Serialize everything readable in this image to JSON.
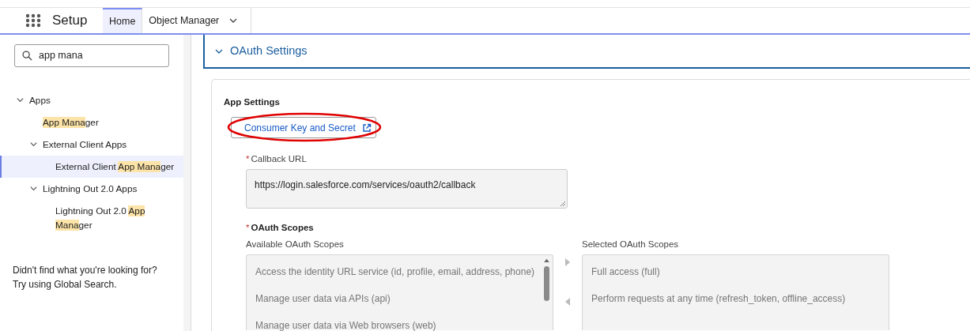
{
  "header": {
    "title": "Setup",
    "tabs": [
      {
        "label": "Home",
        "selected": true,
        "dropdown": false
      },
      {
        "label": "Object Manager",
        "selected": false,
        "dropdown": true
      }
    ]
  },
  "sidebar": {
    "search": {
      "value": "app mana"
    },
    "tree": [
      {
        "parts": [
          {
            "text": "Apps",
            "match": false
          }
        ],
        "expanded": true,
        "selected": false,
        "children": [
          {
            "parts": [
              {
                "text": "App Mana",
                "match": true
              },
              {
                "text": "ger",
                "match": false
              }
            ],
            "selected": false
          },
          {
            "parts": [
              {
                "text": "External Client Apps",
                "match": false
              }
            ],
            "expanded": true,
            "selected": false,
            "children": [
              {
                "parts": [
                  {
                    "text": "External Client ",
                    "match": false
                  },
                  {
                    "text": "App Mana",
                    "match": true
                  },
                  {
                    "text": "ger",
                    "match": false
                  }
                ],
                "selected": true
              }
            ]
          },
          {
            "parts": [
              {
                "text": "Lightning Out 2.0 Apps",
                "match": false
              }
            ],
            "expanded": true,
            "selected": false,
            "children": [
              {
                "parts": [
                  {
                    "text": "Lightning Out 2.0 ",
                    "match": false
                  },
                  {
                    "text": "App Mana",
                    "match": true
                  },
                  {
                    "text": "ger",
                    "match": false
                  }
                ],
                "selected": false
              }
            ]
          }
        ]
      }
    ],
    "hint": "Didn't find what you're looking for? Try using Global Search."
  },
  "section": {
    "title": "OAuth Settings",
    "expanded": true,
    "app_settings": {
      "heading": "App Settings",
      "button": {
        "label": "Consumer Key and Secret",
        "circled": true
      }
    },
    "callback_url": {
      "label": "Callback URL",
      "required_mark": "*",
      "value": "https://login.salesforce.com/services/oauth2/callback"
    },
    "scopes": {
      "label": "OAuth Scopes",
      "required_mark": "*",
      "available": {
        "label": "Available OAuth Scopes",
        "items": [
          "Access the identity URL service (id, profile, email, address, phone)",
          "Manage user data via APIs (api)",
          "Manage user data via Web browsers (web)"
        ]
      },
      "selected": {
        "label": "Selected OAuth Scopes",
        "items": [
          "Full access (full)",
          "Perform requests at any time (refresh_token, offline_access)"
        ]
      }
    }
  }
}
